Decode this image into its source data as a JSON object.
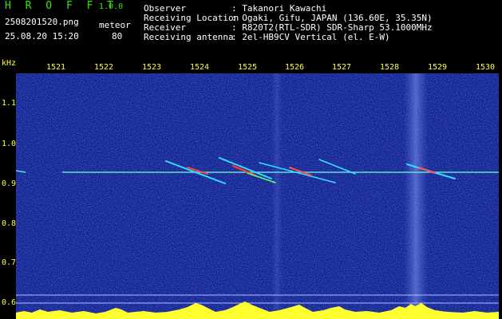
{
  "header": {
    "app_title": "H R O F F T",
    "version": "1.0.0",
    "filename": "2508201520.png",
    "mode": "meteor",
    "datetime": "25.08.20 15:20",
    "count": "80",
    "info": [
      {
        "label": "Observer",
        "value": ": Takanori Kawachi"
      },
      {
        "label": "Receiving Location",
        "value": ": Ogaki, Gifu, JAPAN (136.60E, 35.35N)"
      },
      {
        "label": "Receiver",
        "value": ": R820T2(RTL-SDR) SDR-Sharp 53.1000MHz"
      },
      {
        "label": "Receiving antenna",
        "value": ": 2el-HB9CV Vertical (el. E-W)"
      }
    ]
  },
  "axes": {
    "unit": "kHz",
    "x_ticks": [
      "1521",
      "1522",
      "1523",
      "1524",
      "1525",
      "1526",
      "1527",
      "1528",
      "1529",
      "1530"
    ],
    "y_ticks": [
      "1.1",
      "1.0",
      "0.9",
      "0.8",
      "0.7",
      "0.6"
    ]
  },
  "colors": {
    "background": "#000000",
    "title_green": "#39e600",
    "tick_yellow": "#ffff40",
    "spectrum_blue": "#1a2a9a"
  }
}
